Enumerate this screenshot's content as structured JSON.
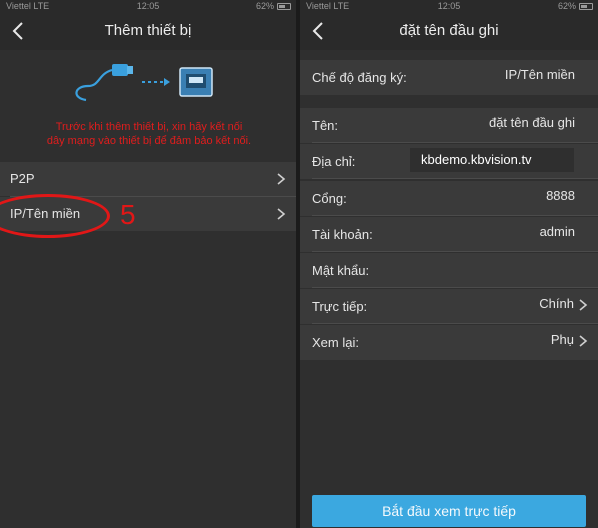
{
  "left": {
    "status": {
      "carrier": "Viettel  LTE",
      "time": "12:05",
      "battery": "62%"
    },
    "nav_title": "Thêm thiết bị",
    "warning_line1": "Trước khi thêm thiết bị, xin hãy kết nối",
    "warning_line2": "dây mạng vào thiết bị để đảm bảo kết nối.",
    "options": [
      {
        "label": "P2P"
      },
      {
        "label": "IP/Tên miền"
      }
    ],
    "annotation_number": "5"
  },
  "right": {
    "status": {
      "carrier": "Viettel  LTE",
      "time": "12:05",
      "battery": "62%"
    },
    "nav_title": "đặt tên đầu ghi",
    "fields": {
      "mode": {
        "label": "Chế độ đăng ký:",
        "value": "IP/Tên miền"
      },
      "name": {
        "label": "Tên:",
        "value": "đặt tên đầu ghi"
      },
      "address": {
        "label": "Địa chỉ:",
        "value": "kbdemo.kbvision.tv"
      },
      "port": {
        "label": "Cổng:",
        "value": "8888"
      },
      "account": {
        "label": "Tài khoản:",
        "value": "admin"
      },
      "password": {
        "label": "Mật khẩu:",
        "value": ""
      },
      "live": {
        "label": "Trực tiếp:",
        "value": "Chính"
      },
      "playback": {
        "label": "Xem lại:",
        "value": "Phụ"
      }
    },
    "cta_label": "Bắt đầu xem trực tiếp"
  },
  "colors": {
    "accent": "#3ba8e0",
    "warning": "#e01d1d",
    "annotation": "#e11717",
    "background": "#2f2f2f"
  }
}
